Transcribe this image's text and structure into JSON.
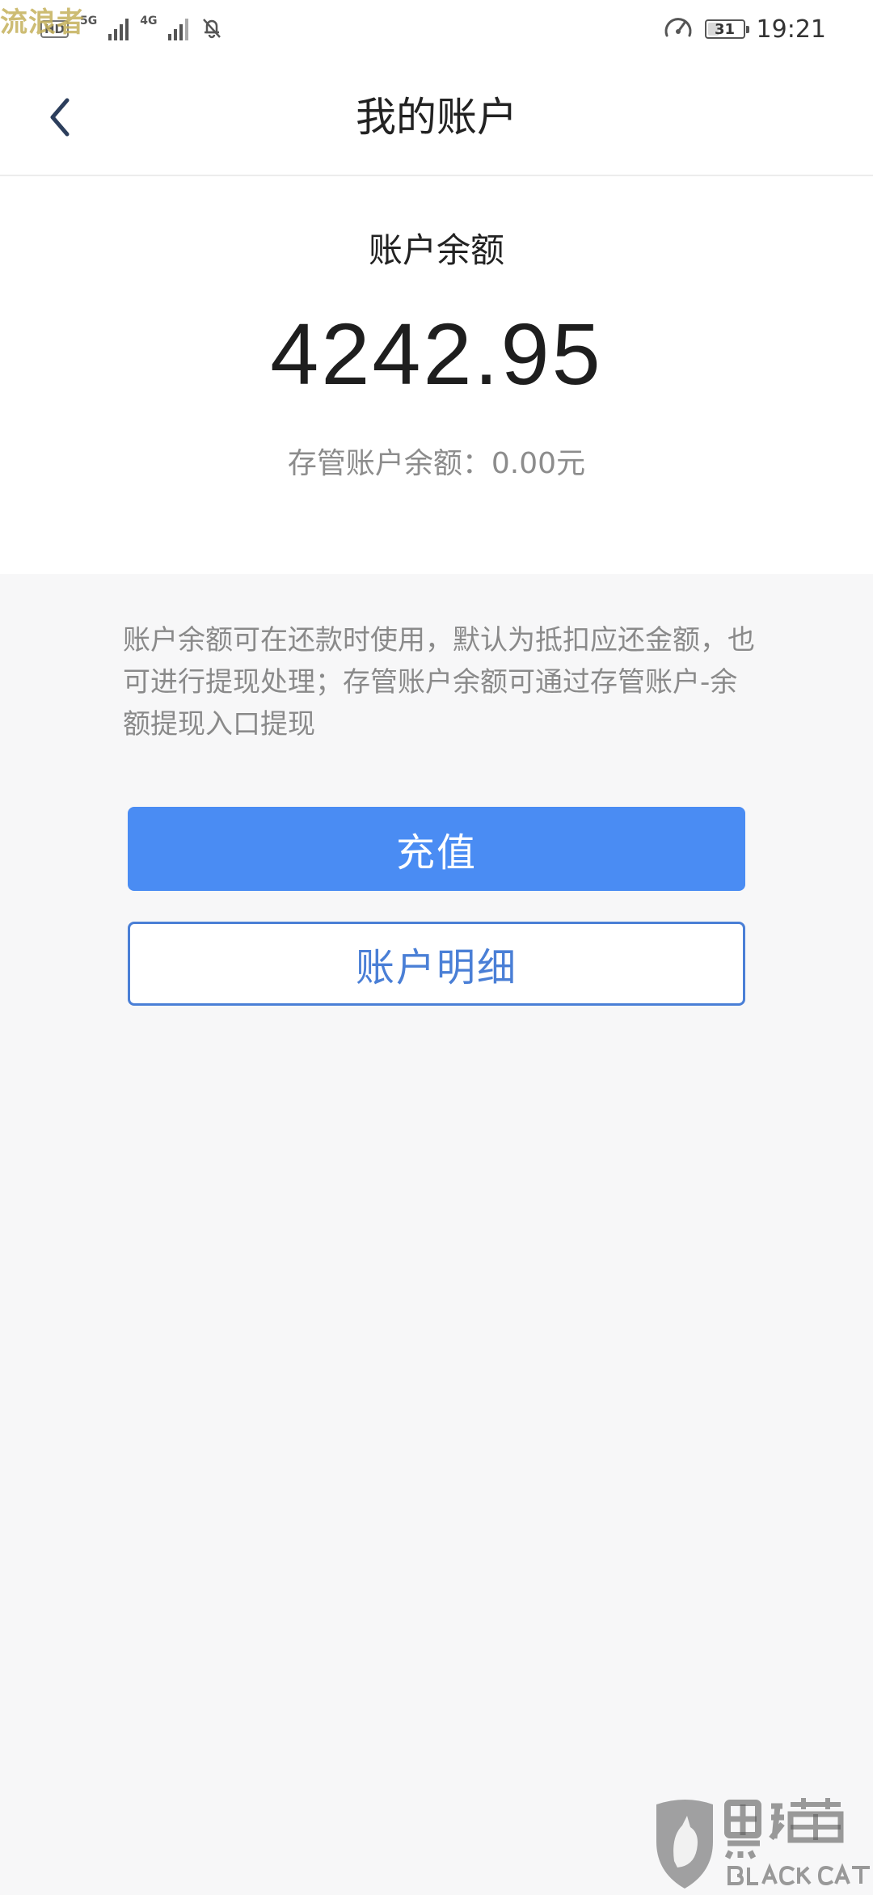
{
  "status_bar": {
    "watermark": "流浪者",
    "hd_badge": "HD",
    "network_1": "5G",
    "network_2": "4G",
    "battery_level": "31",
    "time": "19:21"
  },
  "nav": {
    "title": "我的账户"
  },
  "balance": {
    "label": "账户余额",
    "amount": "4242.95",
    "custody_text": "存管账户余额：0.00元"
  },
  "notice": {
    "text": "账户余额可在还款时使用，默认为抵扣应还金额，也可进行提现处理；存管账户余额可通过存管账户-余额提现入口提现"
  },
  "buttons": {
    "recharge": "充值",
    "account_detail": "账户明细"
  },
  "icons": {
    "back": "back-arrow-icon",
    "signal": "signal-icon",
    "mute": "bell-off-icon",
    "speed": "speedometer-icon",
    "battery": "battery-icon"
  },
  "colors": {
    "primary": "#4a8cf3",
    "outline": "#4a7fd6",
    "background": "#f7f7f8"
  }
}
